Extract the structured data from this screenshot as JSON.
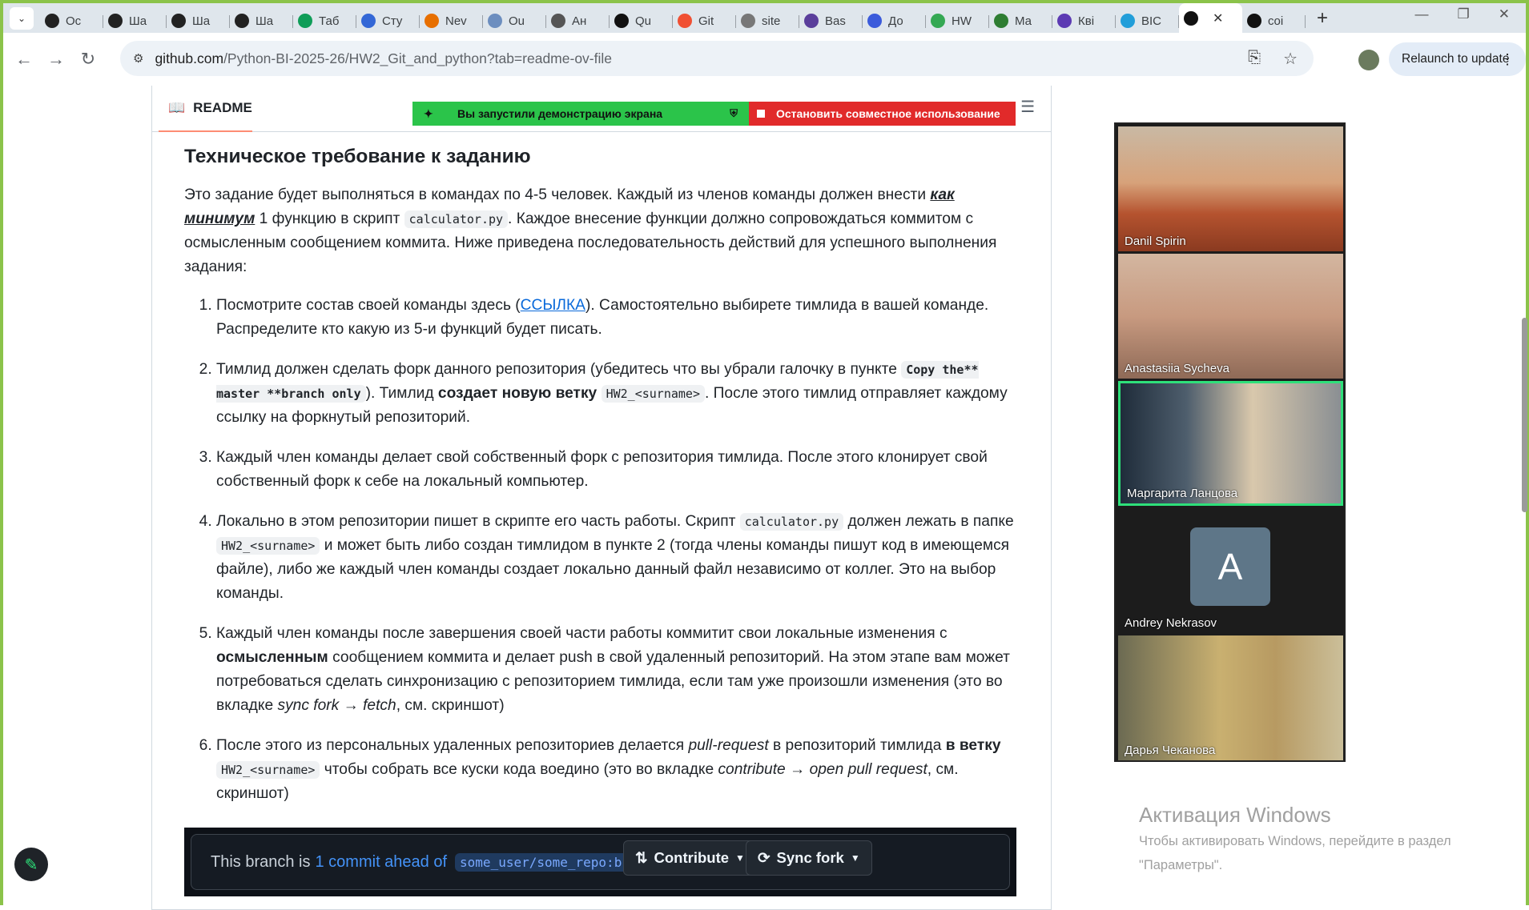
{
  "browser": {
    "tabs": [
      {
        "label": "Ос",
        "icon": "openai-icon",
        "color": "#222222"
      },
      {
        "label": "Ша",
        "icon": "openai-icon",
        "color": "#222222"
      },
      {
        "label": "Ша",
        "icon": "openai-icon",
        "color": "#222222"
      },
      {
        "label": "Ша",
        "icon": "openai-icon",
        "color": "#222222"
      },
      {
        "label": "Таб",
        "icon": "sheets-icon",
        "color": "#0f9d58"
      },
      {
        "label": "Сту",
        "icon": "frame-icon",
        "color": "#3367d6"
      },
      {
        "label": "Nev",
        "icon": "java-icon",
        "color": "#e76f00"
      },
      {
        "label": "Ou",
        "icon": "r-icon",
        "color": "#6c8ebf"
      },
      {
        "label": "Ан",
        "icon": "globe-icon",
        "color": "#555555"
      },
      {
        "label": "Qu",
        "icon": "wikipedia-icon",
        "color": "#111111"
      },
      {
        "label": "Git",
        "icon": "git-icon",
        "color": "#f05033"
      },
      {
        "label": "site",
        "icon": "globe-icon",
        "color": "#777777"
      },
      {
        "label": "Bas",
        "icon": "github-icon",
        "color": "#5a3e9b"
      },
      {
        "label": "До",
        "icon": "profile-icon",
        "color": "#3b5bdb"
      },
      {
        "label": "HW",
        "icon": "drive-icon",
        "color": "#34a853"
      },
      {
        "label": "Ма",
        "icon": "mathway-icon",
        "color": "#2e7d32"
      },
      {
        "label": "Кві",
        "icon": "quiz-icon",
        "color": "#5c3ab3"
      },
      {
        "label": "BIC",
        "icon": "telegram-icon",
        "color": "#229ed9"
      },
      {
        "label": "",
        "icon": "github-icon",
        "color": "#111111",
        "active": true
      },
      {
        "label": "coi",
        "icon": "github-icon",
        "color": "#111111"
      }
    ],
    "url_domain": "github.com",
    "url_path": "/Python-BI-2025-26/HW2_Git_and_python?tab=readme-ov-file",
    "relaunch_label": "Relaunch to update"
  },
  "share_banner": {
    "left_text": "Вы запустили демонстрацию экрана",
    "right_text": "Остановить совместное использование"
  },
  "readme": {
    "tab_label": "README",
    "heading": "Техническое требование к заданию",
    "intro_a": "Это задание будет выполняться в командах по 4-5 человек. Каждый из членов команды должен внести ",
    "intro_em": "как минимум",
    "intro_b": " 1 функцию в скрипт ",
    "intro_code": "calculator.py",
    "intro_c": ". Каждое внесение функции должно сопровождаться коммитом с осмысленным сообщением коммита. Ниже приведена последовательность действий для успешного выполнения задания:",
    "steps": {
      "s1_a": "Посмотрите состав своей команды здесь (",
      "s1_link": "ССЫЛКА",
      "s1_b": "). Самостоятельно выбирете тимлида в вашей команде. Распределите кто какую из 5-и функций будет писать.",
      "s2_a": "Тимлид должен сделать форк данного репозитория (убедитесь что вы убрали галочку в пункте ",
      "s2_code": "Copy the** master **branch only",
      "s2_b": "). Тимлид ",
      "s2_bold": "создает новую ветку",
      "s2_code2": "HW2_<surname>",
      "s2_c": ". После этого тимлид отправляет каждому ссылку на форкнутый репозиторий.",
      "s3": "Каждый член команды делает свой собственный форк с репозитория тимлида. После этого клонирует свой собственный форк к себе на локальный компьютер.",
      "s4_a": "Локально в этом репозитории пишет в скрипте его часть работы. Скрипт ",
      "s4_code": "calculator.py",
      "s4_b": " должен лежать в папке ",
      "s4_code2": "HW2_<surname>",
      "s4_c": " и может быть либо создан тимлидом в пункте 2 (тогда члены команды пишут код в имеющемся файле), либо же каждый член команды создает локально данный файл независимо от коллег. Это на выбор команды.",
      "s5_a": "Каждый член команды после завершения своей части работы коммитит свои локальные изменения с ",
      "s5_bold": "осмысленным",
      "s5_b": " сообщением коммита и делает push в свой удаленный репозиторий. На этом этапе вам может потребоваться сделать синхронизацию с репозиторием тимлида, если там уже произошли изменения (это во вкладке ",
      "s5_em": "sync fork → fetch",
      "s5_c": ", см. скриншот)",
      "s6_a": "После этого из персональных удаленных репозиториев делается ",
      "s6_em": "pull-request",
      "s6_b": " в репозиторий тимлида ",
      "s6_bold": "в ветку",
      "s6_code": "HW2_<surname>",
      "s6_c": " чтобы собрать все куски кода воедино (это во вкладке ",
      "s6_em2": "contribute → open pull request",
      "s6_d": ", см. скриншот)"
    },
    "screenshot": {
      "text_a": "This branch is",
      "text_link": "1 commit ahead of",
      "branch_code": "some_user/some_repo:branch",
      "text_end": ".",
      "contribute_label": "Contribute",
      "sync_label": "Sync fork"
    }
  },
  "video": {
    "participants": [
      {
        "name": "Danil Spirin",
        "bg": "#b5532f"
      },
      {
        "name": "Anastasiia Sycheva",
        "bg": "#c89a80"
      },
      {
        "name": "Маргарита Ланцова",
        "bg": "#3a4a5a",
        "highlight": true
      },
      {
        "name": "Andrey Nekrasov",
        "avatar_letter": "A"
      },
      {
        "name": "Дарья Чеканова",
        "bg": "#b79a62"
      }
    ]
  },
  "watermark": {
    "title": "Активация Windows",
    "line1": "Чтобы активировать Windows, перейдите в раздел",
    "line2": "\"Параметры\"."
  }
}
